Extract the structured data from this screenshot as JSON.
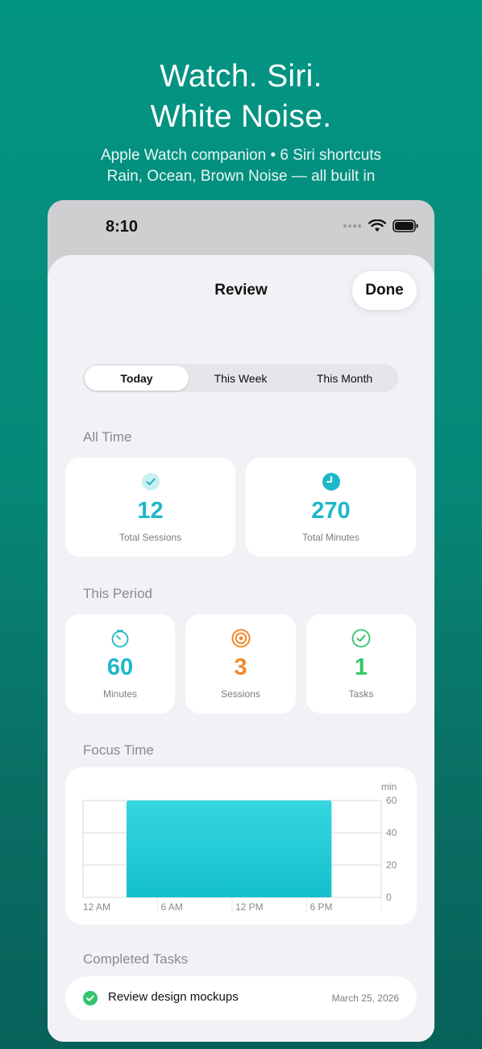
{
  "promo": {
    "title_line1": "Watch. Siri.",
    "title_line2": "White Noise.",
    "subtitle_line1": "Apple Watch companion • 6 Siri shortcuts",
    "subtitle_line2": "Rain, Ocean, Brown Noise — all built in"
  },
  "status_bar": {
    "time": "8:10"
  },
  "nav": {
    "title": "Review",
    "done_label": "Done"
  },
  "segments": [
    {
      "label": "Today",
      "selected": true
    },
    {
      "label": "This Week",
      "selected": false
    },
    {
      "label": "This Month",
      "selected": false
    }
  ],
  "all_time": {
    "title": "All Time",
    "cards": [
      {
        "value": "12",
        "label": "Total Sessions",
        "icon": "checkmark-circle-icon",
        "color": "#1cb8c9"
      },
      {
        "value": "270",
        "label": "Total Minutes",
        "icon": "clock-icon",
        "color": "#1cb8c9"
      }
    ]
  },
  "this_period": {
    "title": "This Period",
    "cards": [
      {
        "value": "60",
        "label": "Minutes",
        "icon": "timer-icon",
        "color": "#1cb8c9"
      },
      {
        "value": "3",
        "label": "Sessions",
        "icon": "target-icon",
        "color": "#f08a2c"
      },
      {
        "value": "1",
        "label": "Tasks",
        "icon": "checkmark-circle-icon",
        "color": "#34c36b"
      }
    ]
  },
  "focus_time": {
    "title": "Focus Time",
    "chart_data": {
      "type": "bar",
      "ylabel": "min",
      "ylim": [
        0,
        60
      ],
      "yticks": [
        "0",
        "20",
        "40",
        "60"
      ],
      "xticks": [
        "12 AM",
        "6 AM",
        "12 PM",
        "6 PM"
      ],
      "series": [
        {
          "x_start_hour": 3.5,
          "x_end_hour": 20,
          "value": 60
        }
      ],
      "bar_color": "#1ec7d3",
      "grid": true
    }
  },
  "completed_tasks": {
    "title": "Completed Tasks",
    "items": [
      {
        "name": "Review design mockups",
        "date": "March 25, 2026"
      }
    ]
  },
  "colors": {
    "accent": "#1cb8c9",
    "orange": "#f08a2c",
    "green": "#34c36b"
  }
}
